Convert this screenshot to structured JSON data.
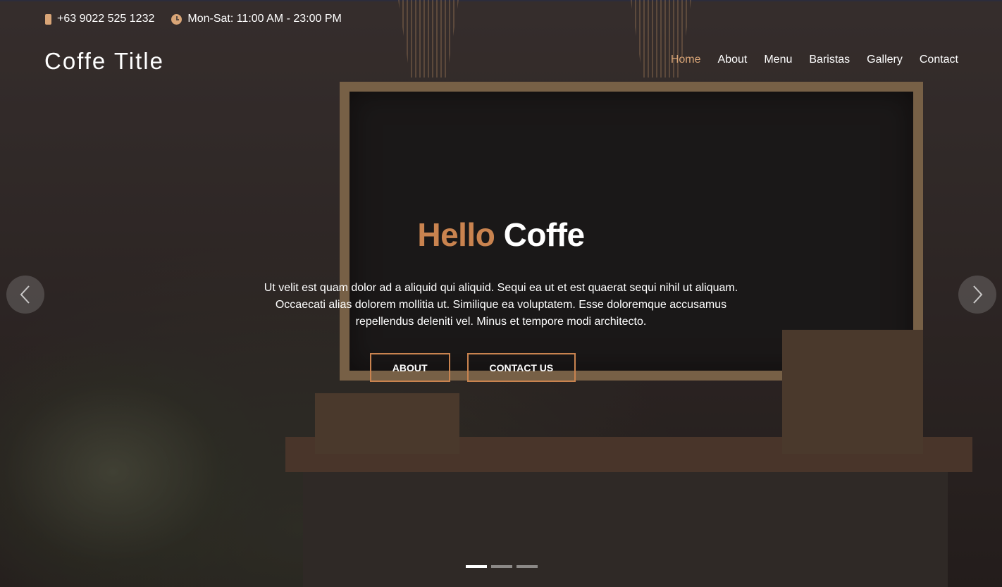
{
  "topbar": {
    "phone": "+63 9022 525 1232",
    "hours": "Mon-Sat: 11:00 AM - 23:00 PM",
    "phone_icon": "phone-icon",
    "clock_icon": "clock-icon"
  },
  "header": {
    "brand": "Coffe Title",
    "nav": [
      {
        "label": "Home",
        "active": true
      },
      {
        "label": "About"
      },
      {
        "label": "Menu"
      },
      {
        "label": "Baristas"
      },
      {
        "label": "Gallery"
      },
      {
        "label": "Contact"
      }
    ]
  },
  "hero": {
    "title_accent": "Hello",
    "title_main": "Coffe",
    "text": "Ut velit est quam dolor ad a aliquid qui aliquid. Sequi ea ut et est quaerat sequi nihil ut aliquam. Occaecati alias dolorem mollitia ut. Similique ea voluptatem. Esse doloremque accusamus repellendus deleniti vel. Minus et tempore modi architecto.",
    "buttons": {
      "about": "ABOUT",
      "contact": "CONTACT US"
    }
  },
  "carousel": {
    "slide_count": 3,
    "active_index": 0,
    "prev_icon": "chevron-left-icon",
    "next_icon": "chevron-right-icon"
  },
  "colors": {
    "accent": "#c9834f",
    "active_nav": "#d9a577"
  }
}
